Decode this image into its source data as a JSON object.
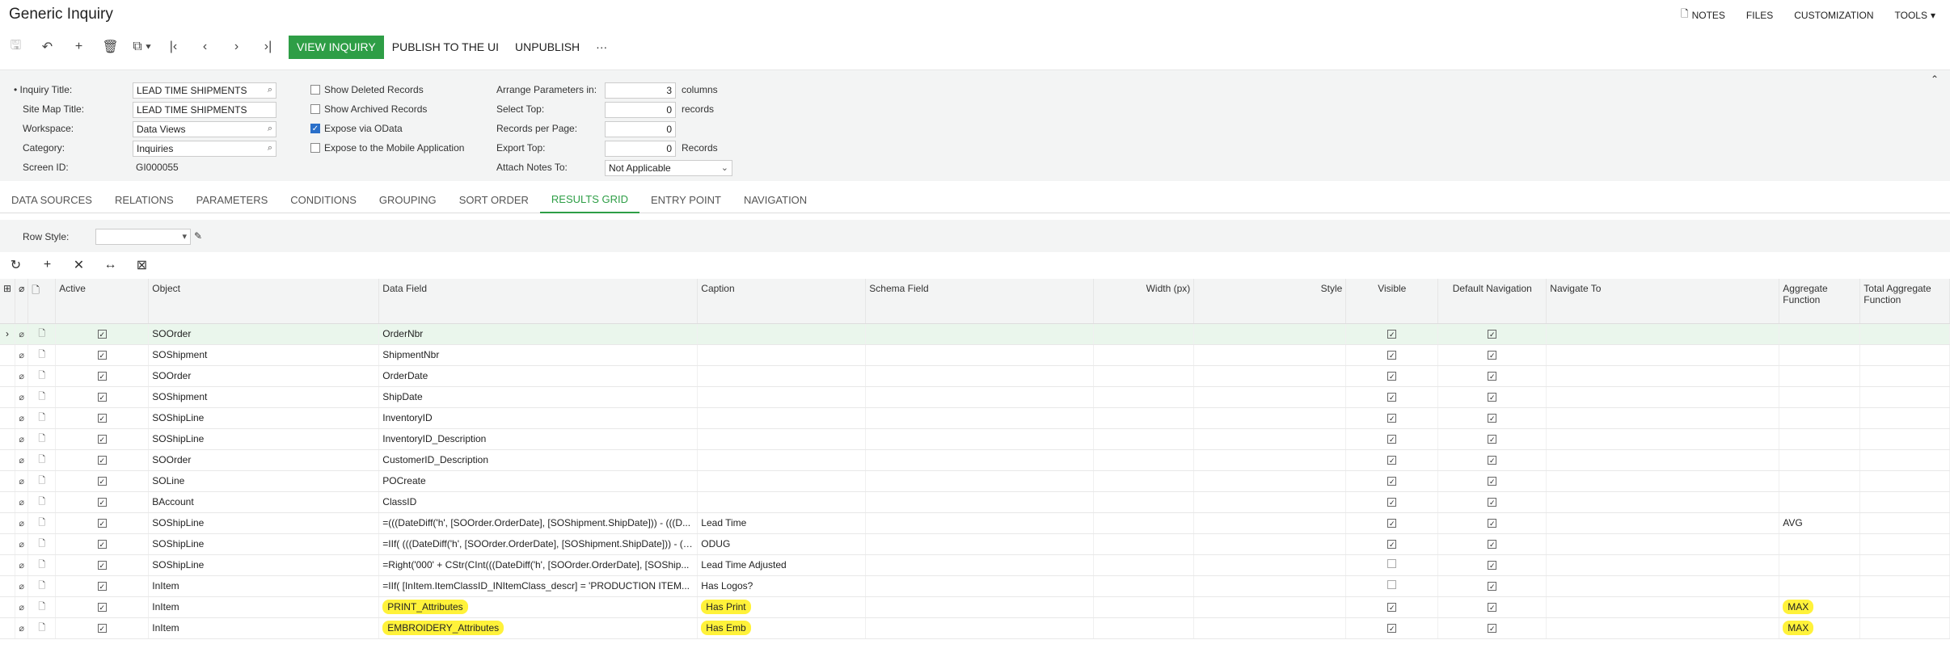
{
  "page": {
    "title": "Generic Inquiry"
  },
  "toplinks": {
    "notes": "NOTES",
    "files": "FILES",
    "customization": "CUSTOMIZATION",
    "tools": "TOOLS"
  },
  "toolbar": {
    "view_inquiry": "VIEW INQUIRY",
    "publish": "PUBLISH TO THE UI",
    "unpublish": "UNPUBLISH",
    "more": "···"
  },
  "form": {
    "inquiry_title_label": "• Inquiry Title:",
    "inquiry_title": "LEAD TIME SHIPMENTS",
    "site_map_title_label": "Site Map Title:",
    "site_map_title": "LEAD TIME SHIPMENTS",
    "workspace_label": "Workspace:",
    "workspace": "Data Views",
    "category_label": "Category:",
    "category": "Inquiries",
    "screen_id_label": "Screen ID:",
    "screen_id": "GI000055",
    "show_deleted": "Show Deleted Records",
    "show_archived": "Show Archived Records",
    "expose_odata": "Expose via OData",
    "expose_mobile": "Expose to the Mobile Application",
    "arrange_label": "Arrange Parameters in:",
    "arrange": "3",
    "arrange_unit": "columns",
    "select_top_label": "Select Top:",
    "select_top": "0",
    "select_top_unit": "records",
    "per_page_label": "Records per Page:",
    "per_page": "0",
    "export_top_label": "Export Top:",
    "export_top": "0",
    "export_top_unit": "Records",
    "attach_label": "Attach Notes To:",
    "attach": "Not Applicable"
  },
  "tabs": [
    "DATA SOURCES",
    "RELATIONS",
    "PARAMETERS",
    "CONDITIONS",
    "GROUPING",
    "SORT ORDER",
    "RESULTS GRID",
    "ENTRY POINT",
    "NAVIGATION"
  ],
  "row_style_label": "Row Style:",
  "columns": {
    "active": "Active",
    "object": "Object",
    "data_field": "Data Field",
    "caption": "Caption",
    "schema_field": "Schema Field",
    "width": "Width (px)",
    "style": "Style",
    "visible": "Visible",
    "default_nav": "Default Navigation",
    "navigate_to": "Navigate To",
    "aggregate": "Aggregate Function",
    "total_aggregate": "Total Aggregate Function"
  },
  "rows": [
    {
      "object": "SOOrder",
      "field": "OrderNbr",
      "caption": "",
      "visible": true,
      "nav": true,
      "agg": ""
    },
    {
      "object": "SOShipment",
      "field": "ShipmentNbr",
      "caption": "",
      "visible": true,
      "nav": true,
      "agg": ""
    },
    {
      "object": "SOOrder",
      "field": "OrderDate",
      "caption": "",
      "visible": true,
      "nav": true,
      "agg": ""
    },
    {
      "object": "SOShipment",
      "field": "ShipDate",
      "caption": "",
      "visible": true,
      "nav": true,
      "agg": ""
    },
    {
      "object": "SOShipLine",
      "field": "InventoryID",
      "caption": "",
      "visible": true,
      "nav": true,
      "agg": ""
    },
    {
      "object": "SOShipLine",
      "field": "InventoryID_Description",
      "caption": "",
      "visible": true,
      "nav": true,
      "agg": ""
    },
    {
      "object": "SOOrder",
      "field": "CustomerID_Description",
      "caption": "",
      "visible": true,
      "nav": true,
      "agg": ""
    },
    {
      "object": "SOLine",
      "field": "POCreate",
      "caption": "",
      "visible": true,
      "nav": true,
      "agg": ""
    },
    {
      "object": "BAccount",
      "field": "ClassID",
      "caption": "",
      "visible": true,
      "nav": true,
      "agg": ""
    },
    {
      "object": "SOShipLine",
      "field": "=(((DateDiff('h', [SOOrder.OrderDate], [SOShipment.ShipDate])) - (((D...",
      "caption": "Lead Time",
      "visible": true,
      "nav": true,
      "agg": "AVG"
    },
    {
      "object": "SOShipLine",
      "field": "=IIf( (((DateDiff('h', [SOOrder.OrderDate], [SOShipment.ShipDate])) - ((...",
      "caption": "ODUG",
      "visible": true,
      "nav": true,
      "agg": ""
    },
    {
      "object": "SOShipLine",
      "field": "=Right('000' + CStr(CInt(((DateDiff('h', [SOOrder.OrderDate], [SOShip...",
      "caption": "Lead Time Adjusted",
      "visible": false,
      "nav": true,
      "agg": ""
    },
    {
      "object": "InItem",
      "field": "=IIf( [InItem.ItemClassID_INItemClass_descr] = 'PRODUCTION ITEM...",
      "caption": "Has Logos?",
      "visible": false,
      "nav": true,
      "agg": ""
    },
    {
      "object": "InItem",
      "field": "PRINT_Attributes",
      "caption": "Has Print",
      "visible": true,
      "nav": true,
      "agg": "MAX",
      "hl": true
    },
    {
      "object": "InItem",
      "field": "EMBROIDERY_Attributes",
      "caption": "Has Emb",
      "visible": true,
      "nav": true,
      "agg": "MAX",
      "hl": true
    }
  ]
}
